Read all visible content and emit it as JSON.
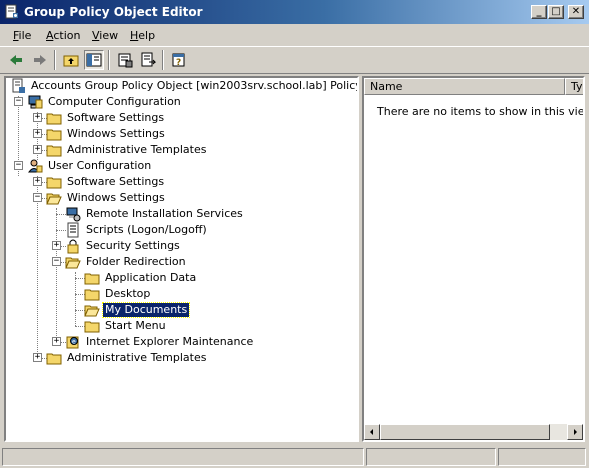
{
  "window": {
    "title": "Group Policy Object Editor",
    "icon": "gpo-editor-icon",
    "controls": [
      "minimize",
      "maximize",
      "close"
    ]
  },
  "menu": {
    "items": [
      {
        "label": "File",
        "accel": "F",
        "rest": "ile"
      },
      {
        "label": "Action",
        "accel": "A",
        "rest": "ction"
      },
      {
        "label": "View",
        "accel": "V",
        "rest": "iew"
      },
      {
        "label": "Help",
        "accel": "H",
        "rest": "elp"
      }
    ]
  },
  "toolbar": {
    "buttons": [
      "back-arrow-icon",
      "forward-arrow-icon",
      "up-folder-icon",
      "show-hide-tree-icon",
      "properties-icon",
      "export-list-icon",
      "help-icon"
    ]
  },
  "tree": {
    "root": "Accounts Group Policy Object [win2003srv.school.lab] Policy",
    "computer_config": "Computer Configuration",
    "cc_software": "Software Settings",
    "cc_windows": "Windows Settings",
    "cc_admin": "Administrative Templates",
    "user_config": "User Configuration",
    "uc_software": "Software Settings",
    "uc_windows": "Windows Settings",
    "ris": "Remote Installation Services",
    "scripts": "Scripts (Logon/Logoff)",
    "security": "Security Settings",
    "folder_redirection": "Folder Redirection",
    "app_data": "Application Data",
    "desktop": "Desktop",
    "my_documents": "My Documents",
    "start_menu": "Start Menu",
    "ie_maintenance": "Internet Explorer Maintenance",
    "uc_admin": "Administrative Templates",
    "selected": "My Documents"
  },
  "list": {
    "columns": [
      "Name",
      "Ty"
    ],
    "empty_message": "There are no items to show in this view."
  },
  "colors": {
    "title_start": "#0a246a",
    "title_end": "#a6caf0",
    "selection": "#0a246a",
    "folder": "#f4d66a",
    "chrome": "#d4d0c8"
  }
}
